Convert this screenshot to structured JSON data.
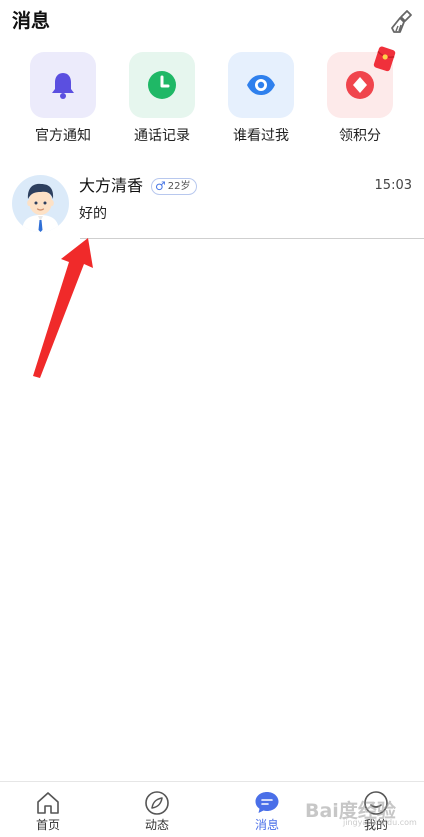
{
  "header": {
    "title": "消息"
  },
  "shortcuts": [
    {
      "label": "官方通知",
      "icon": "bell-icon",
      "tile_color": "#ecebfb",
      "icon_color": "#5b4fe0"
    },
    {
      "label": "通话记录",
      "icon": "clock-icon",
      "tile_color": "#e6f6ee",
      "icon_color": "#1fb866"
    },
    {
      "label": "谁看过我",
      "icon": "eye-icon",
      "tile_color": "#e6f0fd",
      "icon_color": "#2f80ed"
    },
    {
      "label": "领积分",
      "icon": "diamond-coin-icon",
      "tile_color": "#fdeaea",
      "icon_color": "#f0454d"
    }
  ],
  "conversation": {
    "name": "大方清香",
    "gender_symbol": "♂",
    "age": "22岁",
    "time": "15:03",
    "preview": "好的"
  },
  "tabs": [
    {
      "label": "首页",
      "icon": "home-icon",
      "active": false
    },
    {
      "label": "动态",
      "icon": "compass-icon",
      "active": false
    },
    {
      "label": "消息",
      "icon": "chat-bubble-icon",
      "active": true
    },
    {
      "label": "我的",
      "icon": "profile-icon",
      "active": false
    }
  ],
  "watermark": {
    "text": "Bai度经验",
    "sub": "jingyan.baidu.com"
  },
  "colors": {
    "accent": "#4a6fe8",
    "annotation_arrow": "#f02a2a"
  }
}
